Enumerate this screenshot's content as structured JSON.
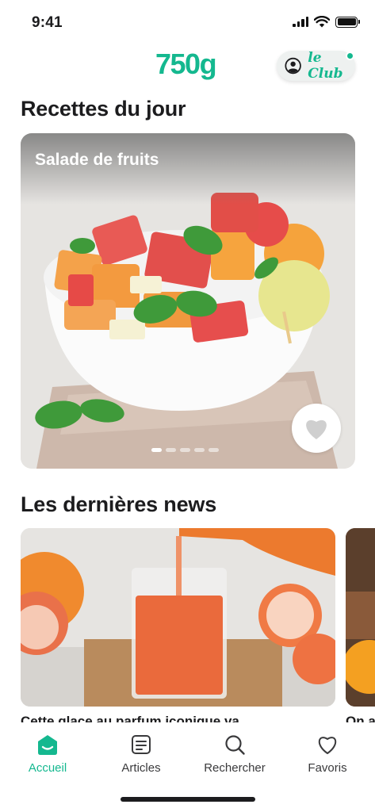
{
  "status_bar": {
    "time": "9:41"
  },
  "header": {
    "logo": "750g",
    "club_label": "le Club"
  },
  "recipes_section": {
    "title": "Recettes du jour",
    "card": {
      "title": "Salade de fruits"
    },
    "pager": {
      "count": 5,
      "active_index": 0
    }
  },
  "news_section": {
    "title": "Les dernières news",
    "items": [
      {
        "caption": "Cette glace au parfum iconique va"
      },
      {
        "caption": "On a"
      }
    ]
  },
  "bottom_nav": {
    "items": [
      {
        "label": "Accueil",
        "icon": "home-icon",
        "active": true
      },
      {
        "label": "Articles",
        "icon": "articles-icon",
        "active": false
      },
      {
        "label": "Rechercher",
        "icon": "search-icon",
        "active": false
      },
      {
        "label": "Favoris",
        "icon": "heart-icon",
        "active": false
      }
    ]
  },
  "colors": {
    "accent": "#14b88f",
    "text": "#1c1c1e"
  }
}
